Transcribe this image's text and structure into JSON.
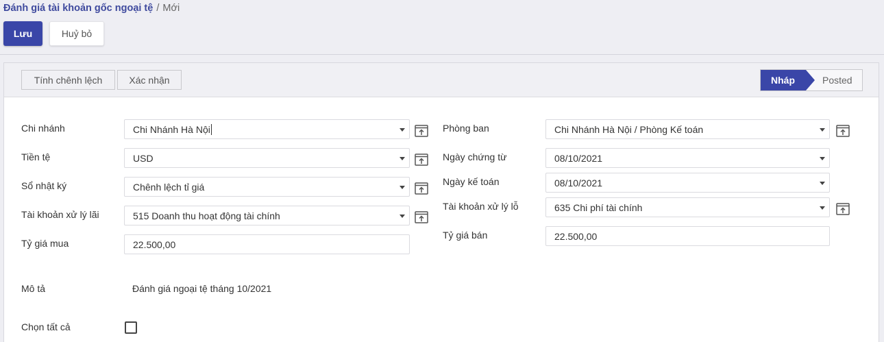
{
  "breadcrumb": {
    "parent": "Đánh giá tài khoản gốc ngoại tệ",
    "separator": "/",
    "current": "Mới"
  },
  "toolbar": {
    "save_label": "Lưu",
    "discard_label": "Huỷ bỏ"
  },
  "statusbar": {
    "compute_label": "Tính chênh lệch",
    "confirm_label": "Xác nhận",
    "stages": [
      "Nháp",
      "Posted"
    ],
    "active_stage": "Nháp"
  },
  "form": {
    "branch": {
      "label": "Chi nhánh",
      "value": "Chi Nhánh Hà Nội"
    },
    "currency": {
      "label": "Tiền tệ",
      "value": "USD"
    },
    "journal": {
      "label": "Sổ nhật ký",
      "value": "Chênh lệch tỉ giá"
    },
    "gain_account": {
      "label": "Tài khoản xử lý lãi",
      "value": "515 Doanh thu hoạt động tài chính"
    },
    "buy_rate": {
      "label": "Tỷ giá mua",
      "value": "22.500,00"
    },
    "department": {
      "label": "Phòng ban",
      "value": "Chi Nhánh Hà Nội / Phòng Kế toán"
    },
    "doc_date": {
      "label": "Ngày chứng từ",
      "value": "08/10/2021"
    },
    "acc_date": {
      "label": "Ngày kế toán",
      "value": "08/10/2021"
    },
    "loss_account": {
      "label": "Tài khoản xử lý lỗ",
      "value": "635 Chi phí tài chính"
    },
    "sell_rate": {
      "label": "Tỷ giá bán",
      "value": "22.500,00"
    },
    "description": {
      "label": "Mô tả",
      "value": "Đánh giá ngoại tệ tháng 10/2021"
    },
    "select_all": {
      "label": "Chọn tất cả",
      "checked": false
    }
  },
  "colors": {
    "primary": "#3a46a8",
    "breadcrumb_link": "#3f4a9e",
    "background": "#eeeef3"
  },
  "icons": {
    "external_link": "external-link-icon",
    "dropdown": "chevron-down-icon"
  }
}
